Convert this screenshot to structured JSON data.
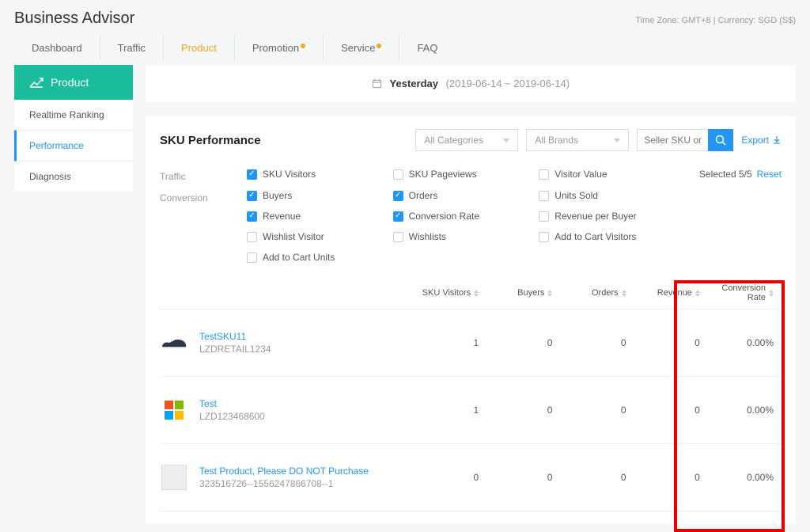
{
  "header": {
    "app_title": "Business Advisor",
    "tz_currency": "Time Zone: GMT+8 | Currency: SGD (S$)",
    "tabs": [
      {
        "label": "Dashboard",
        "active": false,
        "dot": false
      },
      {
        "label": "Traffic",
        "active": false,
        "dot": false
      },
      {
        "label": "Product",
        "active": true,
        "dot": false
      },
      {
        "label": "Promotion",
        "active": false,
        "dot": true
      },
      {
        "label": "Service",
        "active": false,
        "dot": true
      },
      {
        "label": "FAQ",
        "active": false,
        "dot": false
      }
    ]
  },
  "sidebar": {
    "header": "Product",
    "items": [
      {
        "label": "Realtime Ranking",
        "active": false
      },
      {
        "label": "Performance",
        "active": true
      },
      {
        "label": "Diagnosis",
        "active": false
      }
    ]
  },
  "date_bar": {
    "label": "Yesterday",
    "range": "(2019-06-14 ~ 2019-06-14)"
  },
  "panel": {
    "title": "SKU Performance",
    "categories_placeholder": "All Categories",
    "brands_placeholder": "All Brands",
    "search_placeholder": "Seller SKU or Name",
    "export_label": "Export",
    "selected_text": "Selected 5/5",
    "reset_label": "Reset"
  },
  "metric_groups": [
    {
      "label": "Traffic",
      "options": [
        {
          "label": "SKU Visitors",
          "checked": true
        },
        {
          "label": "SKU Pageviews",
          "checked": false
        },
        {
          "label": "Visitor Value",
          "checked": false
        }
      ]
    },
    {
      "label": "Conversion",
      "options": [
        {
          "label": "Buyers",
          "checked": true
        },
        {
          "label": "Orders",
          "checked": true
        },
        {
          "label": "Units Sold",
          "checked": false
        },
        {
          "label": "Revenue",
          "checked": true
        },
        {
          "label": "Conversion Rate",
          "checked": true
        },
        {
          "label": "Revenue per Buyer",
          "checked": false
        },
        {
          "label": "Wishlist Visitor",
          "checked": false
        },
        {
          "label": "Wishlists",
          "checked": false
        },
        {
          "label": "Add to Cart Visitors",
          "checked": false
        },
        {
          "label": "Add to Cart Units",
          "checked": false
        }
      ]
    }
  ],
  "table": {
    "columns": [
      "SKU Visitors",
      "Buyers",
      "Orders",
      "Revenue",
      "Conversion Rate"
    ],
    "rows": [
      {
        "name": "TestSKU11",
        "code": "LZDRETAIL1234",
        "values": [
          "1",
          "0",
          "0",
          "0",
          "0.00%"
        ],
        "thumb": "shoe"
      },
      {
        "name": "Test",
        "code": "LZD123468600",
        "values": [
          "1",
          "0",
          "0",
          "0",
          "0.00%"
        ],
        "thumb": "ms"
      },
      {
        "name": "Test Product, Please DO NOT Purchase",
        "code": "323516726--1556247866708--1",
        "values": [
          "0",
          "0",
          "0",
          "0",
          "0.00%"
        ],
        "thumb": "blank"
      }
    ]
  }
}
